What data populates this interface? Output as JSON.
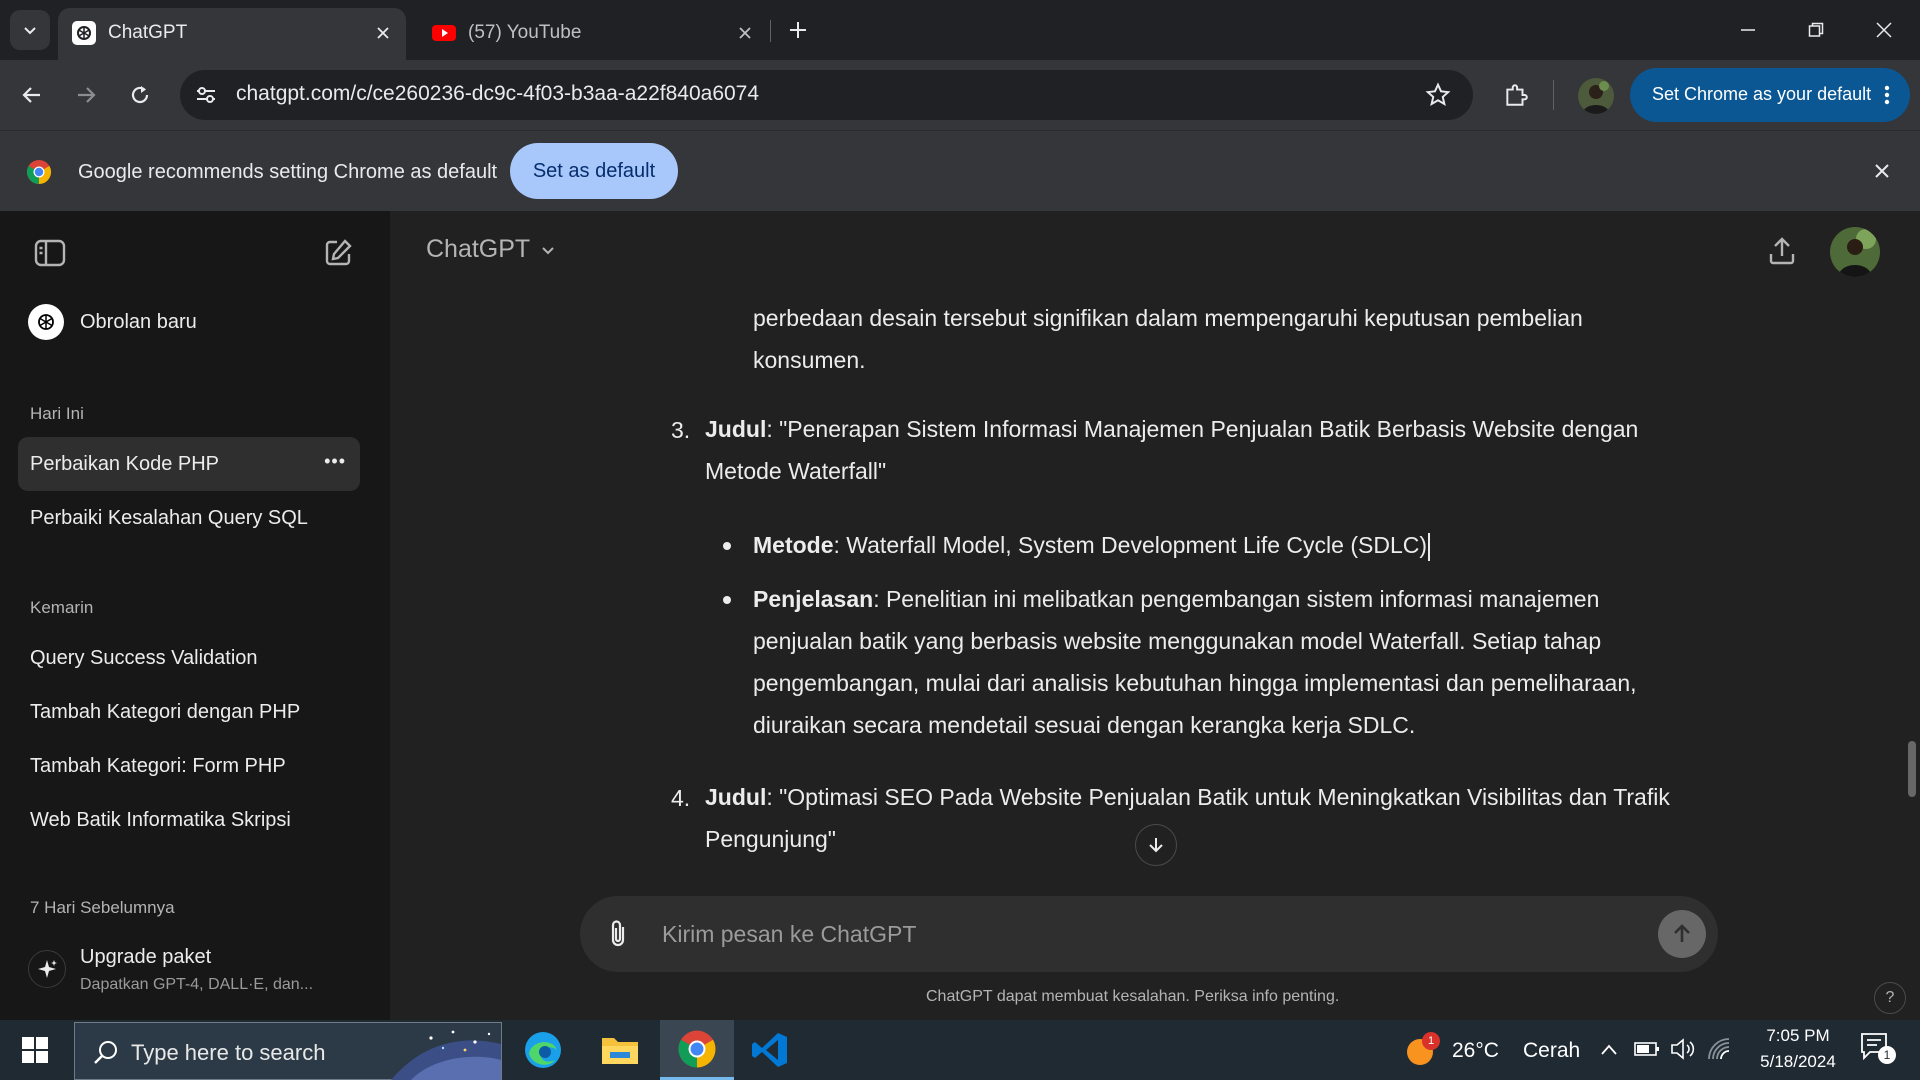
{
  "browser": {
    "tabs": [
      {
        "title": "ChatGPT",
        "favicon": "openai-icon",
        "active": true
      },
      {
        "title": "(57) YouTube",
        "favicon": "youtube-icon",
        "active": false
      }
    ],
    "url": "chatgpt.com/c/ce260236-dc9c-4f03-b3aa-a22f840a6074",
    "default_button": "Set Chrome as your default",
    "infobar": {
      "message": "Google recommends setting Chrome as default",
      "button": "Set as default"
    },
    "colors": {
      "tabstrip": "#202124",
      "toolbar": "#35363a",
      "pill": "#0b5794",
      "infobar_button": "#a8c7fa"
    }
  },
  "sidebar": {
    "new_chat": "Obrolan baru",
    "sections": [
      {
        "label": "Hari Ini",
        "items": [
          "Perbaikan Kode PHP",
          "Perbaiki Kesalahan Query SQL"
        ]
      },
      {
        "label": "Kemarin",
        "items": [
          "Query Success Validation",
          "Tambah Kategori dengan PHP",
          "Tambah Kategori: Form PHP",
          "Web Batik Informatika Skripsi"
        ]
      },
      {
        "label": "7 Hari Sebelumnya",
        "items": []
      }
    ],
    "selected_more": "•••",
    "upgrade": {
      "title": "Upgrade paket",
      "subtitle": "Dapatkan GPT-4, DALL·E, dan..."
    }
  },
  "header": {
    "model": "ChatGPT"
  },
  "message": {
    "continuation": [
      "perbedaan desain tersebut signifikan dalam mempengaruhi keputusan pembelian",
      "konsumen."
    ],
    "items": [
      {
        "number": "3.",
        "label": "Judul",
        "lines": [
          ": \"Penerapan Sistem Informasi Manajemen Penjualan Batik Berbasis Website dengan",
          "Metode Waterfall\""
        ],
        "bullets": [
          {
            "label": "Metode",
            "lines": [
              ": Waterfall Model, System Development Life Cycle (SDLC)"
            ]
          },
          {
            "label": "Penjelasan",
            "lines": [
              ": Penelitian ini melibatkan pengembangan sistem informasi manajemen",
              "penjualan batik yang berbasis website menggunakan model Waterfall. Setiap tahap",
              "pengembangan, mulai dari analisis kebutuhan hingga implementasi dan pemeliharaan,",
              "diuraikan secara mendetail sesuai dengan kerangka kerja SDLC."
            ]
          }
        ]
      },
      {
        "number": "4.",
        "label": "Judul",
        "lines": [
          ": \"Optimasi SEO Pada Website Penjualan Batik untuk Meningkatkan Visibilitas dan Trafik",
          "Pengunjung\""
        ]
      }
    ]
  },
  "composer": {
    "placeholder": "Kirim pesan ke ChatGPT"
  },
  "disclaimer": "ChatGPT dapat membuat kesalahan. Periksa info penting.",
  "help": "?",
  "taskbar": {
    "search_placeholder": "Type here to search",
    "weather": {
      "temp": "26°C",
      "condition": "Cerah",
      "badge": "1"
    },
    "time": "7:05 PM",
    "date": "5/18/2024",
    "notification_count": "1"
  }
}
